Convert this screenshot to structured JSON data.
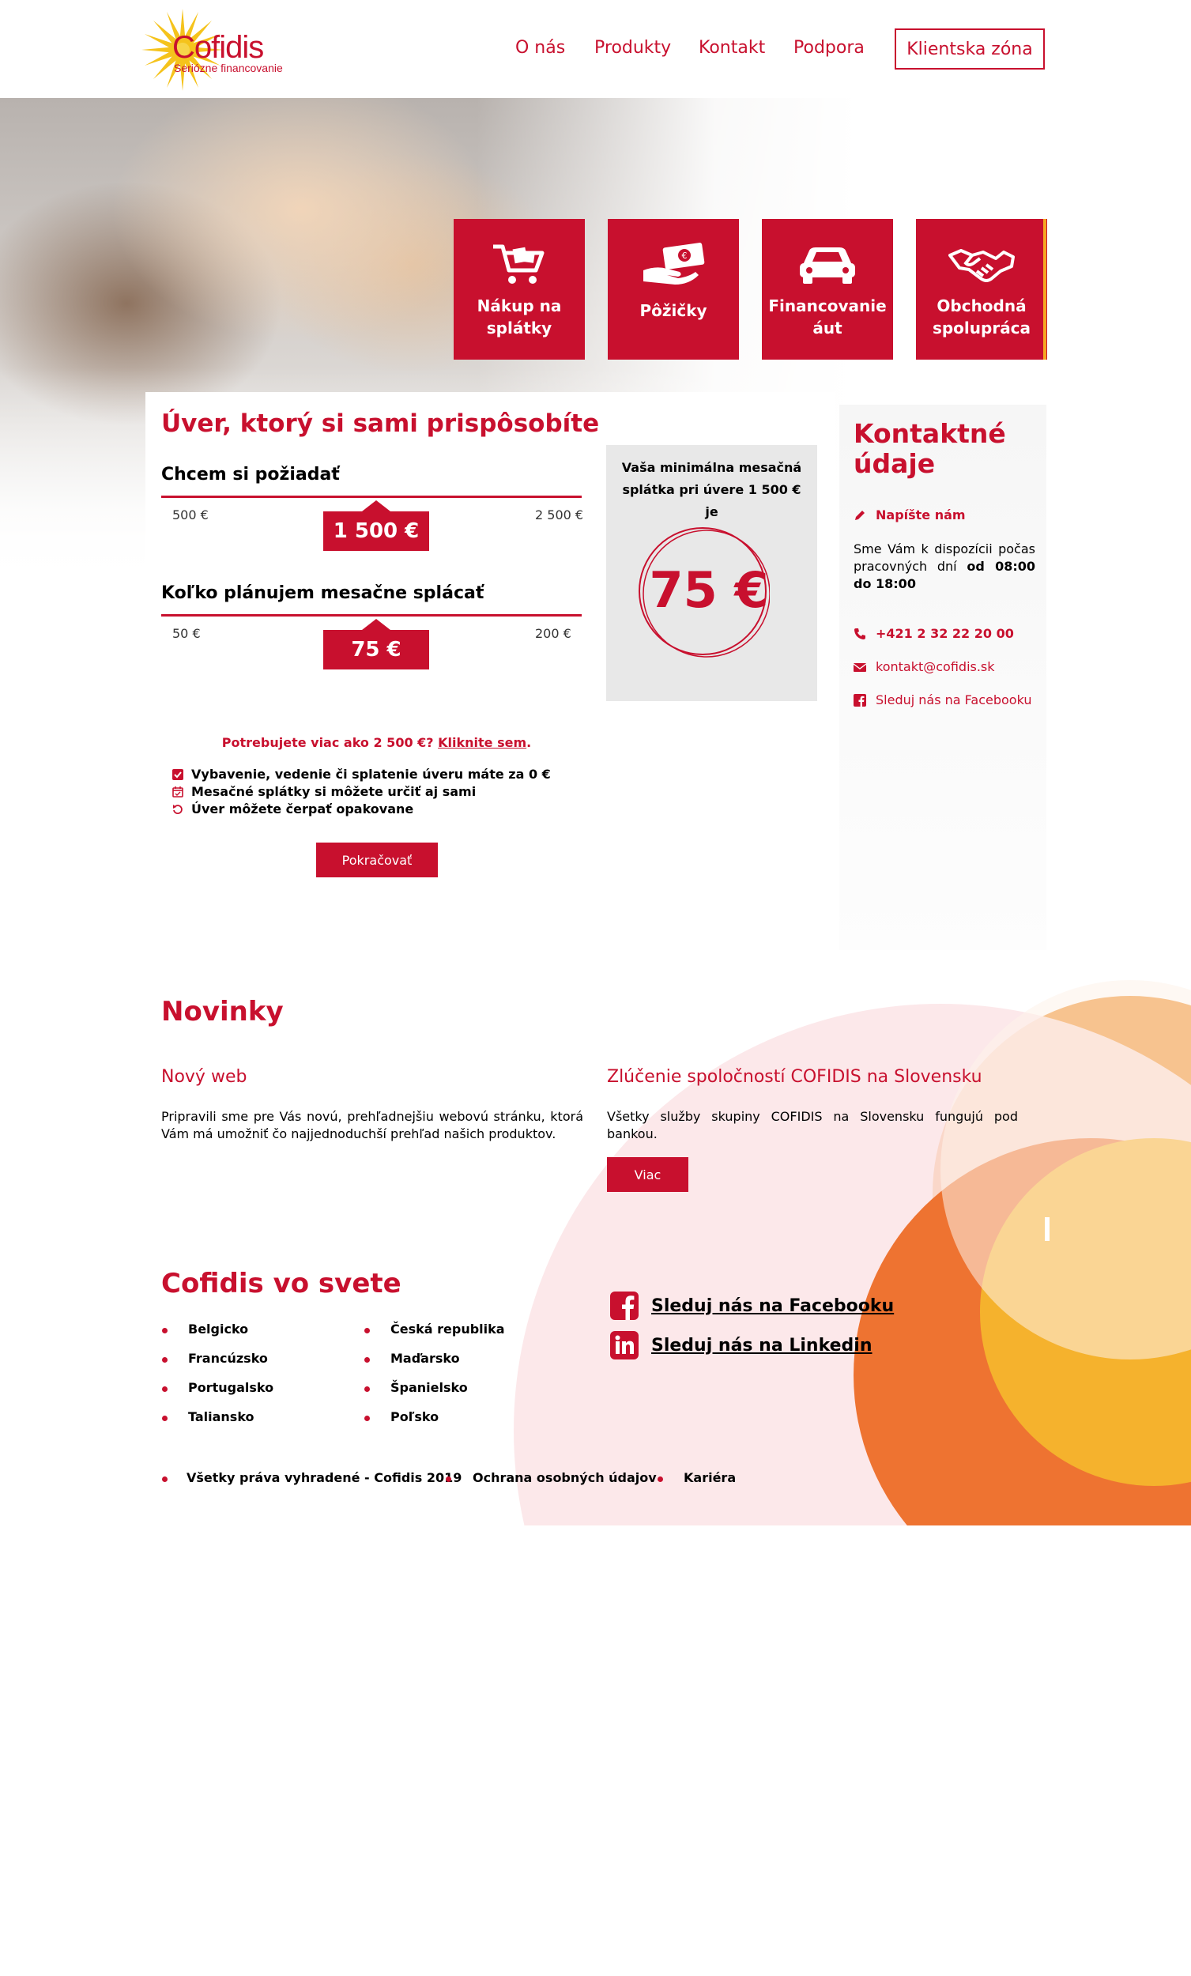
{
  "brand": {
    "name": "Cofidis",
    "tagline": "Seriózne financovanie",
    "primary_color": "#c8102e",
    "accent_orange": "#ef8b22",
    "accent_yellow": "#f5b22d"
  },
  "nav": {
    "items": [
      "O nás",
      "Produkty",
      "Kontakt",
      "Podpora"
    ],
    "client_zone": "Klientska zóna"
  },
  "tiles": [
    {
      "label": "Nákup na splátky",
      "icon": "shopping-cart-icon"
    },
    {
      "label": "Pôžičky",
      "icon": "money-hand-icon"
    },
    {
      "label": "Financovanie áut",
      "icon": "car-icon"
    },
    {
      "label": "Obchodná spolupráca",
      "icon": "handshake-icon"
    }
  ],
  "calculator": {
    "title": "Úver, ktorý si sami prispôsobíte",
    "amount": {
      "question": "Chcem si požiadať",
      "min": "500 €",
      "max": "2 500 €",
      "value": "1 500 €"
    },
    "payment": {
      "question": "Koľko plánujem mesačne splácať",
      "min": "50 €",
      "max": "200 €",
      "value": "75 €"
    },
    "result_text": "Vaša minimálna mesačná splátka pri úvere 1 500 € je",
    "result_value": "75 €",
    "more_prefix": "Potrebujete viac ako 2 500 €?",
    "more_link": "Kliknite sem",
    "more_suffix": ".",
    "benefits": [
      "Vybavenie, vedenie či splatenie úveru máte za 0 €",
      "Mesačné splátky si môžete určiť aj sami",
      "Úver môžete čerpať opakovane"
    ],
    "continue": "Pokračovať"
  },
  "contact": {
    "title": "Kontaktné údaje",
    "write_us": "Napíšte nám",
    "hours_prefix": "Sme Vám k dispozícii počas pracovných dní",
    "hours_value": "od 08:00 do 18:00",
    "phone": "+421 2 32 22 20 00",
    "email": "kontakt@cofidis.sk",
    "facebook": "Sleduj nás na Facebooku"
  },
  "news": {
    "title": "Novinky",
    "items": [
      {
        "heading": "Nový web",
        "text": "Pripravili sme pre Vás novú, prehľadnejšiu webovú stránku, ktorá Vám má umožniť čo najjednoduchší prehľad našich produktov."
      },
      {
        "heading": "Zlúčenie spoločností COFIDIS na Slovensku",
        "text": "Všetky služby skupiny COFIDIS na Slovensku fungujú pod bankou."
      }
    ],
    "more": "Viac"
  },
  "world": {
    "title": "Cofidis vo svete",
    "countries_left": [
      "Belgicko",
      "Francúzsko",
      "Portugalsko",
      "Taliansko"
    ],
    "countries_right": [
      "Česká republika",
      "Maďarsko",
      "Španielsko",
      "Poľsko"
    ]
  },
  "social": {
    "facebook": "Sleduj nás na Facebooku",
    "linkedin": "Sleduj nás na Linkedin"
  },
  "footer": {
    "copyright": "Všetky práva vyhradené - Cofidis 2019",
    "privacy": "Ochrana osobných údajov",
    "career": "Kariéra"
  }
}
